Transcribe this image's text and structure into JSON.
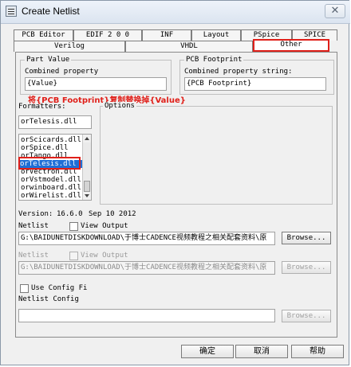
{
  "window": {
    "title": "Create Netlist",
    "close_glyph": "✕"
  },
  "tabs_row1": [
    "PCB Editor",
    "EDIF 2 0 0",
    "INF",
    "Layout",
    "PSpice",
    "SPICE"
  ],
  "tabs_row2": [
    "Verilog",
    "VHDL",
    "Other"
  ],
  "part_value": {
    "group_label": "Part Value",
    "combined_label": "Combined property",
    "value": "{Value}"
  },
  "pcb_footprint": {
    "group_label": "PCB Footprint",
    "combined_label": "Combined property string:",
    "value": "{PCB Footprint}"
  },
  "annotation": "将{PCB Footprint}复制替换掉{Value}",
  "formatters": {
    "label": "Formatters:",
    "value": "orTelesis.dll",
    "items": [
      "orScicards.dll",
      "orSpice.dll",
      "orTango.dll",
      "orTelesis.dll",
      "orVectron.dll",
      "orVstmodel.dll",
      "orwinboard.dll",
      "orWirelist.dll"
    ],
    "selected": "orTelesis.dll"
  },
  "options_label": "Options",
  "version": {
    "label": "Version:",
    "value": "16.6.0",
    "date": "Sep 10 2012"
  },
  "netlist": {
    "label": "Netlist",
    "path": "G:\\BAIDUNETDISKDOWNLOAD\\于博士CADENCE视频教程之相关配套资料\\原",
    "view_output": "View Output",
    "browse": "Browse..."
  },
  "netlist2": {
    "label": "Netlist",
    "path": "G:\\BAIDUNETDISKDOWNLOAD\\于博士CADENCE视频教程之相关配套资料\\原",
    "view_output": "View Output",
    "browse": "Browse..."
  },
  "config": {
    "use_config": "Use Config Fi",
    "label": "Netlist Config",
    "value": "",
    "browse": "Browse..."
  },
  "buttons": {
    "ok": "确定",
    "cancel": "取消",
    "help": "帮助"
  },
  "colors": {
    "highlight_red": "#e0201a",
    "selection_blue": "#1f6fd6"
  },
  "icons": [
    "app-icon",
    "close-icon",
    "scroll-up-icon",
    "scroll-down-icon"
  ]
}
